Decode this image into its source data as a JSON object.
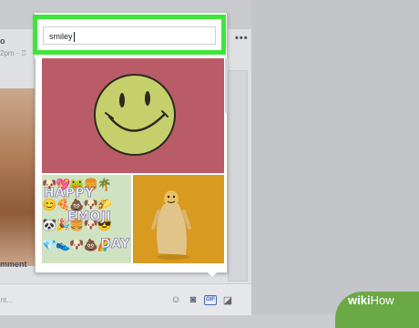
{
  "post": {
    "author_fragment": "o",
    "time_fragment": "2pm · ",
    "more_label": "•••",
    "comment_label": "mment",
    "comment_placeholder": "ent..."
  },
  "comment_icons": {
    "emoji": "☺",
    "camera": "◙",
    "gif": "GIF",
    "sticker": "◪"
  },
  "gif_picker": {
    "search_value": "smiley",
    "results": [
      {
        "name": "yellow smiley face"
      },
      {
        "words": [
          "HAPPY",
          "EMOJI",
          "DAY"
        ]
      },
      {
        "name": "yellow costume figure"
      }
    ]
  },
  "watermark": {
    "wiki": "wiki",
    "how": "How"
  },
  "colors": {
    "highlight": "#3ee63a",
    "gif_pink": "#b95c67",
    "smiley_yellow": "#c5d06c",
    "gif_orange": "#d79a1e",
    "watermark_green": "#6aaa46"
  }
}
